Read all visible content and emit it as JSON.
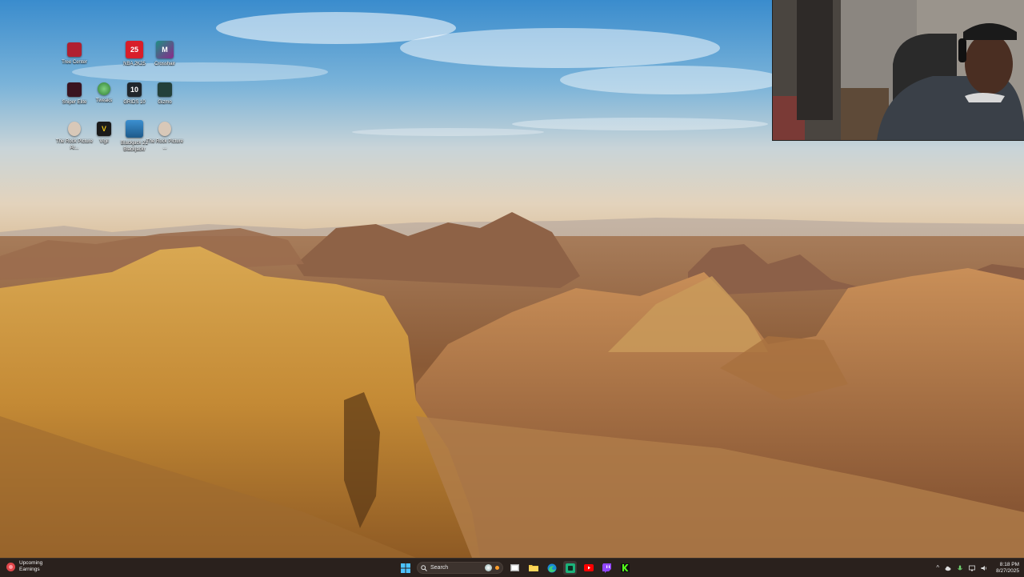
{
  "desktop": {
    "icons": [
      {
        "label": "Tree Center",
        "icon": "tree-center-icon",
        "color": "#b02030",
        "glyph": ""
      },
      {
        "label": "NBA 2K25",
        "icon": "nba2k25-icon",
        "color": "#d81e2a",
        "glyph": "25"
      },
      {
        "label": "Crosshair",
        "icon": "crosshair-app-icon",
        "color": "#1f6f68",
        "glyph": "M"
      },
      {
        "label": "Sniper Elite",
        "icon": "sniper-elite-icon",
        "color": "#3a1420",
        "glyph": ""
      },
      {
        "label": "Tweaks",
        "icon": "tweaks-app-icon",
        "color": "#2e7d32",
        "glyph": ""
      },
      {
        "label": "GRIDS 10",
        "icon": "grids-app-icon",
        "color": "#20262b",
        "glyph": "10"
      },
      {
        "label": "Gizmo",
        "icon": "gizmo-app-icon",
        "color": "#23403a",
        "glyph": ""
      },
      {
        "label": "The Rock Picture Ar...",
        "icon": "rock-picture-icon-1",
        "color": "#6b4a3a",
        "glyph": ""
      },
      {
        "label": "Vigil",
        "icon": "vigil-app-icon",
        "color": "#1a1a1a",
        "glyph": "V"
      },
      {
        "label": "Blackjack 21 Blackjackr",
        "icon": "blackjack-app-icon",
        "color": "#2a6fa3",
        "glyph": ""
      },
      {
        "label": "The Rock Picture ...",
        "icon": "rock-picture-icon-2",
        "color": "#6b4a3a",
        "glyph": ""
      }
    ]
  },
  "taskbar": {
    "weather": {
      "line1": "Upcoming",
      "line2": "Earnings"
    },
    "search_placeholder": "Search",
    "pinned": [
      {
        "name": "start-button",
        "icon": "windows-start-icon"
      },
      {
        "name": "task-view-button",
        "icon": "task-view-icon"
      },
      {
        "name": "file-explorer-button",
        "icon": "folder-icon"
      },
      {
        "name": "edge-button",
        "icon": "edge-icon"
      },
      {
        "name": "app-green-button",
        "icon": "green-app-icon"
      },
      {
        "name": "youtube-button",
        "icon": "youtube-icon"
      },
      {
        "name": "twitch-button",
        "icon": "twitch-icon"
      },
      {
        "name": "kick-button",
        "icon": "kick-icon"
      }
    ],
    "tray": {
      "chevron": "^",
      "time": "8:18 PM",
      "date": "8/27/2025"
    }
  },
  "colors": {
    "taskbar": "#2a211d",
    "sky_top": "#3d8fce",
    "sand": "#c9913e"
  }
}
